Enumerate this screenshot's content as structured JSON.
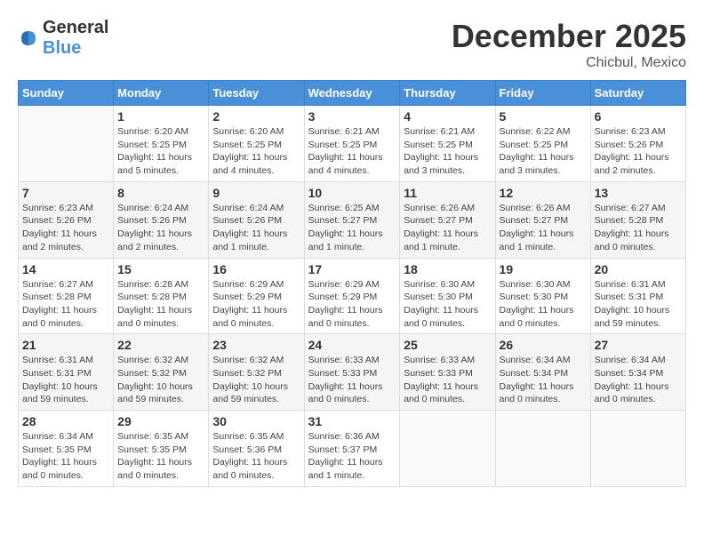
{
  "logo": {
    "general": "General",
    "blue": "Blue"
  },
  "title": {
    "month": "December 2025",
    "location": "Chicbul, Mexico"
  },
  "days_of_week": [
    "Sunday",
    "Monday",
    "Tuesday",
    "Wednesday",
    "Thursday",
    "Friday",
    "Saturday"
  ],
  "weeks": [
    [
      {
        "day": "",
        "info": ""
      },
      {
        "day": "1",
        "info": "Sunrise: 6:20 AM\nSunset: 5:25 PM\nDaylight: 11 hours\nand 5 minutes."
      },
      {
        "day": "2",
        "info": "Sunrise: 6:20 AM\nSunset: 5:25 PM\nDaylight: 11 hours\nand 4 minutes."
      },
      {
        "day": "3",
        "info": "Sunrise: 6:21 AM\nSunset: 5:25 PM\nDaylight: 11 hours\nand 4 minutes."
      },
      {
        "day": "4",
        "info": "Sunrise: 6:21 AM\nSunset: 5:25 PM\nDaylight: 11 hours\nand 3 minutes."
      },
      {
        "day": "5",
        "info": "Sunrise: 6:22 AM\nSunset: 5:25 PM\nDaylight: 11 hours\nand 3 minutes."
      },
      {
        "day": "6",
        "info": "Sunrise: 6:23 AM\nSunset: 5:26 PM\nDaylight: 11 hours\nand 2 minutes."
      }
    ],
    [
      {
        "day": "7",
        "info": "Sunrise: 6:23 AM\nSunset: 5:26 PM\nDaylight: 11 hours\nand 2 minutes."
      },
      {
        "day": "8",
        "info": "Sunrise: 6:24 AM\nSunset: 5:26 PM\nDaylight: 11 hours\nand 2 minutes."
      },
      {
        "day": "9",
        "info": "Sunrise: 6:24 AM\nSunset: 5:26 PM\nDaylight: 11 hours\nand 1 minute."
      },
      {
        "day": "10",
        "info": "Sunrise: 6:25 AM\nSunset: 5:27 PM\nDaylight: 11 hours\nand 1 minute."
      },
      {
        "day": "11",
        "info": "Sunrise: 6:26 AM\nSunset: 5:27 PM\nDaylight: 11 hours\nand 1 minute."
      },
      {
        "day": "12",
        "info": "Sunrise: 6:26 AM\nSunset: 5:27 PM\nDaylight: 11 hours\nand 1 minute."
      },
      {
        "day": "13",
        "info": "Sunrise: 6:27 AM\nSunset: 5:28 PM\nDaylight: 11 hours\nand 0 minutes."
      }
    ],
    [
      {
        "day": "14",
        "info": "Sunrise: 6:27 AM\nSunset: 5:28 PM\nDaylight: 11 hours\nand 0 minutes."
      },
      {
        "day": "15",
        "info": "Sunrise: 6:28 AM\nSunset: 5:28 PM\nDaylight: 11 hours\nand 0 minutes."
      },
      {
        "day": "16",
        "info": "Sunrise: 6:29 AM\nSunset: 5:29 PM\nDaylight: 11 hours\nand 0 minutes."
      },
      {
        "day": "17",
        "info": "Sunrise: 6:29 AM\nSunset: 5:29 PM\nDaylight: 11 hours\nand 0 minutes."
      },
      {
        "day": "18",
        "info": "Sunrise: 6:30 AM\nSunset: 5:30 PM\nDaylight: 11 hours\nand 0 minutes."
      },
      {
        "day": "19",
        "info": "Sunrise: 6:30 AM\nSunset: 5:30 PM\nDaylight: 11 hours\nand 0 minutes."
      },
      {
        "day": "20",
        "info": "Sunrise: 6:31 AM\nSunset: 5:31 PM\nDaylight: 10 hours\nand 59 minutes."
      }
    ],
    [
      {
        "day": "21",
        "info": "Sunrise: 6:31 AM\nSunset: 5:31 PM\nDaylight: 10 hours\nand 59 minutes."
      },
      {
        "day": "22",
        "info": "Sunrise: 6:32 AM\nSunset: 5:32 PM\nDaylight: 10 hours\nand 59 minutes."
      },
      {
        "day": "23",
        "info": "Sunrise: 6:32 AM\nSunset: 5:32 PM\nDaylight: 10 hours\nand 59 minutes."
      },
      {
        "day": "24",
        "info": "Sunrise: 6:33 AM\nSunset: 5:33 PM\nDaylight: 11 hours\nand 0 minutes."
      },
      {
        "day": "25",
        "info": "Sunrise: 6:33 AM\nSunset: 5:33 PM\nDaylight: 11 hours\nand 0 minutes."
      },
      {
        "day": "26",
        "info": "Sunrise: 6:34 AM\nSunset: 5:34 PM\nDaylight: 11 hours\nand 0 minutes."
      },
      {
        "day": "27",
        "info": "Sunrise: 6:34 AM\nSunset: 5:34 PM\nDaylight: 11 hours\nand 0 minutes."
      }
    ],
    [
      {
        "day": "28",
        "info": "Sunrise: 6:34 AM\nSunset: 5:35 PM\nDaylight: 11 hours\nand 0 minutes."
      },
      {
        "day": "29",
        "info": "Sunrise: 6:35 AM\nSunset: 5:35 PM\nDaylight: 11 hours\nand 0 minutes."
      },
      {
        "day": "30",
        "info": "Sunrise: 6:35 AM\nSunset: 5:36 PM\nDaylight: 11 hours\nand 0 minutes."
      },
      {
        "day": "31",
        "info": "Sunrise: 6:36 AM\nSunset: 5:37 PM\nDaylight: 11 hours\nand 1 minute."
      },
      {
        "day": "",
        "info": ""
      },
      {
        "day": "",
        "info": ""
      },
      {
        "day": "",
        "info": ""
      }
    ]
  ]
}
